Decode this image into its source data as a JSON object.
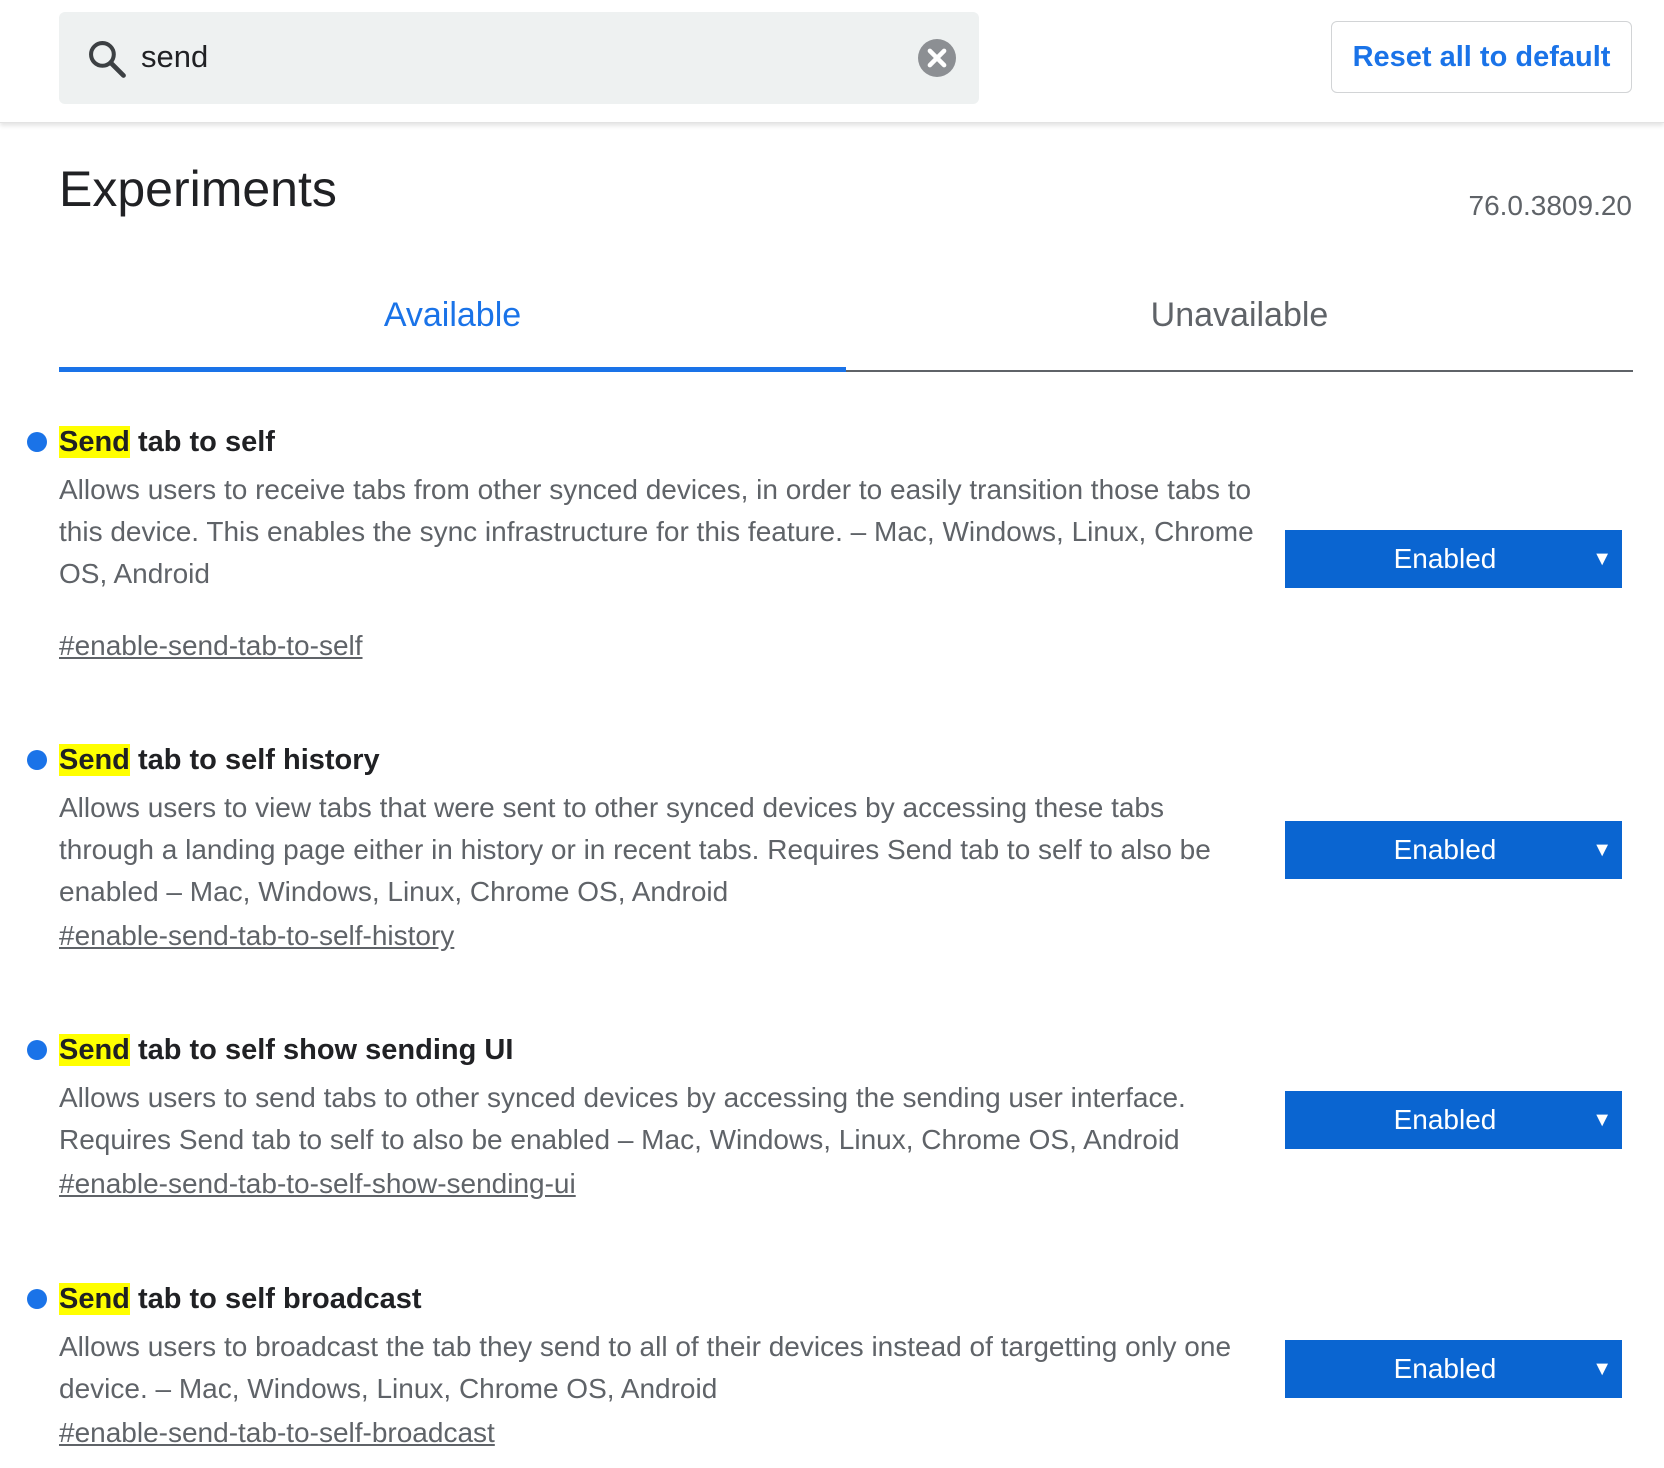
{
  "search": {
    "value": "send"
  },
  "header": {
    "reset_label": "Reset all to default"
  },
  "page": {
    "title": "Experiments",
    "version": "76.0.3809.20"
  },
  "tabs": [
    {
      "label": "Available",
      "active": true
    },
    {
      "label": "Unavailable",
      "active": false
    }
  ],
  "experiments": [
    {
      "title_highlight": "Send",
      "title_rest": " tab to self",
      "description": "Allows users to receive tabs from other synced devices, in order to easily transition those tabs to this device. This enables the sync infrastructure for this feature. – Mac, Windows, Linux, Chrome OS, Android",
      "link": "#enable-send-tab-to-self",
      "state": "Enabled"
    },
    {
      "title_highlight": "Send",
      "title_rest": " tab to self history",
      "description": "Allows users to view tabs that were sent to other synced devices by accessing these tabs through a landing page either in history or in recent tabs. Requires Send tab to self to also be enabled – Mac, Windows, Linux, Chrome OS, Android",
      "link": "#enable-send-tab-to-self-history",
      "state": "Enabled"
    },
    {
      "title_highlight": "Send",
      "title_rest": " tab to self show sending UI",
      "description": "Allows users to send tabs to other synced devices by accessing the sending user interface. Requires Send tab to self to also be enabled – Mac, Windows, Linux, Chrome OS, Android",
      "link": "#enable-send-tab-to-self-show-sending-ui",
      "state": "Enabled"
    },
    {
      "title_highlight": "Send",
      "title_rest": " tab to self broadcast",
      "description": "Allows users to broadcast the tab they send to all of their devices instead of targetting only one device. – Mac, Windows, Linux, Chrome OS, Android",
      "link": "#enable-send-tab-to-self-broadcast",
      "state": "Enabled"
    }
  ],
  "colors": {
    "accent": "#1a73e8",
    "select_bg": "#0a65d1",
    "highlight": "#ffff00",
    "search_bg": "#eef1f1"
  },
  "icons": {
    "search": "search-icon",
    "clear": "close-circle-icon",
    "dropdown": "triangle-down-icon"
  }
}
